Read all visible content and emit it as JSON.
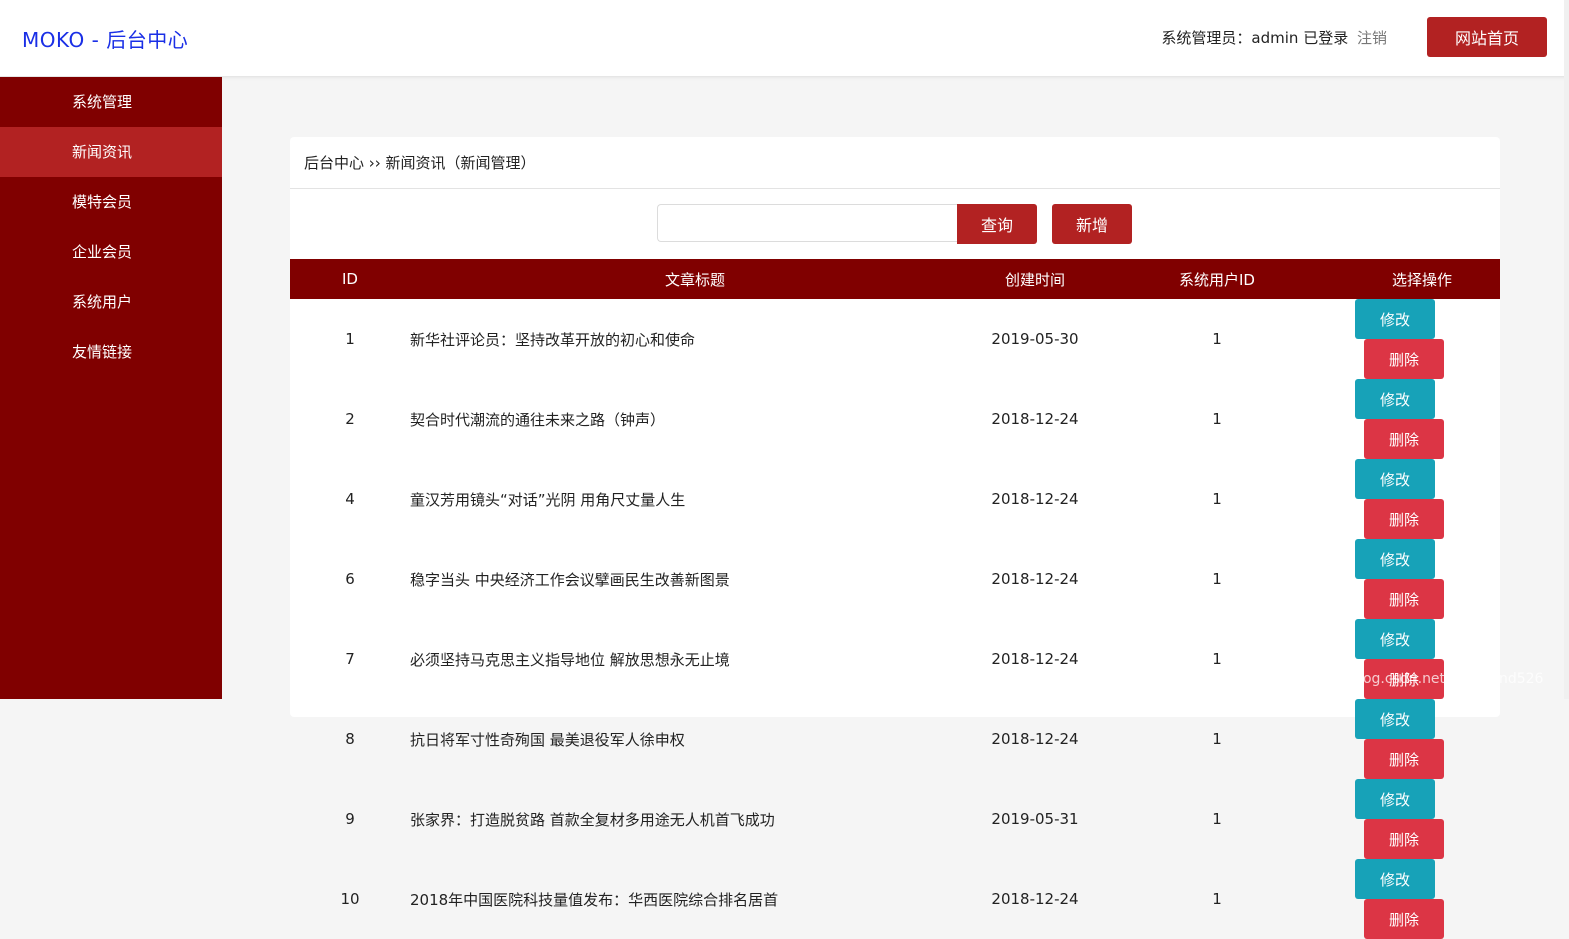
{
  "header": {
    "logo": "MOKO - 后台中心",
    "user_text": "系统管理员：admin 已登录",
    "logout": "注销",
    "home_button": "网站首页"
  },
  "sidebar": {
    "items": [
      {
        "label": "系统管理"
      },
      {
        "label": "新闻资讯",
        "active": true
      },
      {
        "label": "模特会员"
      },
      {
        "label": "企业会员"
      },
      {
        "label": "系统用户"
      },
      {
        "label": "友情链接"
      }
    ]
  },
  "breadcrumb": "后台中心 ›› 新闻资讯（新闻管理）",
  "search": {
    "value": "",
    "query_button": "查询",
    "add_button": "新增"
  },
  "table": {
    "headers": [
      "ID",
      "文章标题",
      "创建时间",
      "系统用户ID",
      "选择操作"
    ],
    "edit_label": "修改",
    "delete_label": "删除",
    "rows": [
      {
        "id": "1",
        "title": "新华社评论员：坚持改革开放的初心和使命",
        "date": "2019-05-30",
        "user_id": "1"
      },
      {
        "id": "2",
        "title": "契合时代潮流的通往未来之路（钟声）",
        "date": "2018-12-24",
        "user_id": "1"
      },
      {
        "id": "4",
        "title": "童汉芳用镜头“对话”光阴 用角尺丈量人生",
        "date": "2018-12-24",
        "user_id": "1"
      },
      {
        "id": "6",
        "title": "稳字当头 中央经济工作会议擘画民生改善新图景",
        "date": "2018-12-24",
        "user_id": "1"
      },
      {
        "id": "7",
        "title": "必须坚持马克思主义指导地位 解放思想永无止境",
        "date": "2018-12-24",
        "user_id": "1"
      },
      {
        "id": "8",
        "title": "抗日将军寸性奇殉国 最美退役军人徐申权",
        "date": "2018-12-24",
        "user_id": "1"
      },
      {
        "id": "9",
        "title": "张家界：打造脱贫路 首款全复材多用途无人机首飞成功",
        "date": "2019-05-31",
        "user_id": "1"
      },
      {
        "id": "10",
        "title": "2018年中国医院科技量值发布：华西医院综合排名居首",
        "date": "2018-12-24",
        "user_id": "1"
      }
    ]
  },
  "watermark": "https://blog.csdn.net/whirlwind526",
  "colors": {
    "brand_dark": "#800000",
    "brand": "#b22222",
    "edit": "#17a2b8",
    "delete": "#dc3545",
    "logo": "#1a2fe6"
  }
}
